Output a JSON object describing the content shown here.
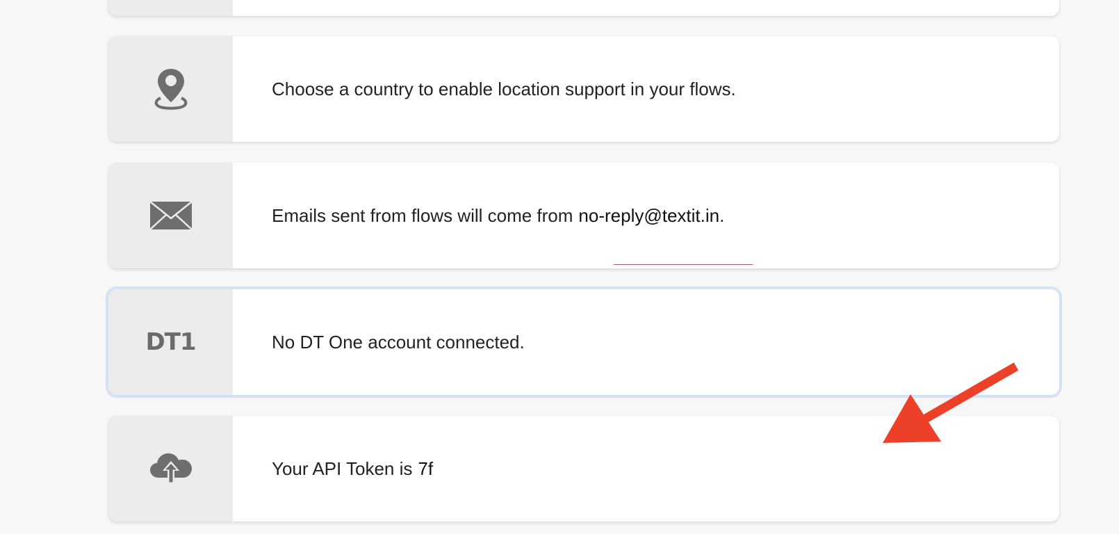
{
  "rows": [
    {
      "icon": "location-pin-icon",
      "text": "Choose a country to enable location support in your flows."
    },
    {
      "icon": "envelope-icon",
      "text": "Emails sent from flows will come from",
      "strong": "no-reply@textit.in",
      "suffix": "."
    },
    {
      "icon": "dt-one-logo",
      "logo_text": "DT1",
      "text": "No DT One account connected."
    },
    {
      "icon": "cloud-upload-icon",
      "text": "Your API Token is",
      "strong": "7f"
    }
  ],
  "colors": {
    "background": "#f7f7f7",
    "card": "#ffffff",
    "icon_column": "#ececec",
    "icon": "#6e6e6e",
    "focus_ring": "#d3e2f6",
    "annotation_arrow": "#ec4128"
  }
}
